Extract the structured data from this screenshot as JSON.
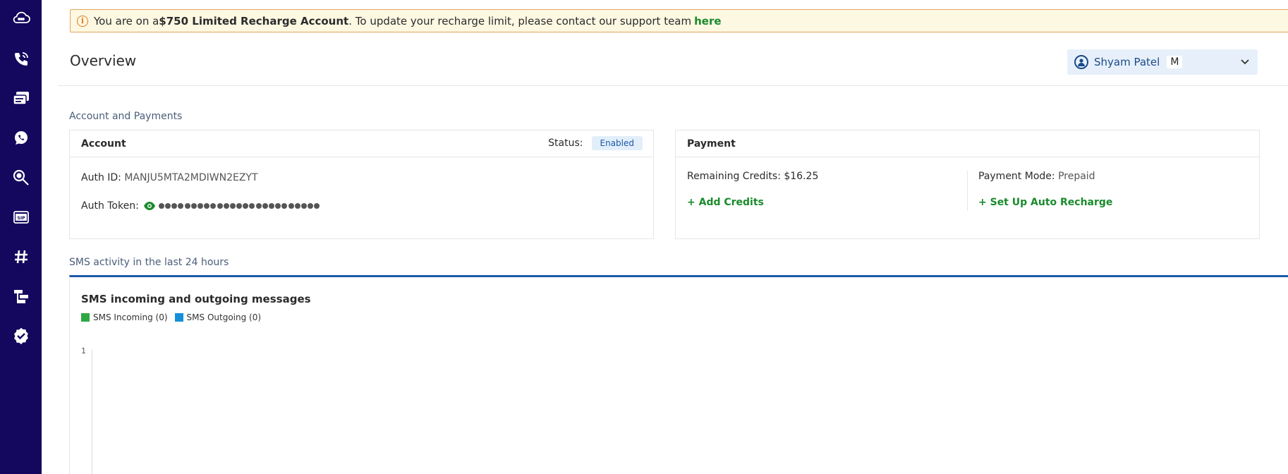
{
  "banner": {
    "prefix": "You are on a ",
    "account_type": "$750 Limited Recharge Account",
    "suffix": ". To update your recharge limit, please contact our support team",
    "link": "here"
  },
  "header": {
    "title": "Overview",
    "user_name": "Shyam Patel",
    "user_initial": "M"
  },
  "sidebar": {
    "items": [
      "cloud-icon",
      "phone-icon",
      "messages-icon",
      "whatsapp-icon",
      "lookup-icon",
      "sip-icon",
      "hashtag-icon",
      "flow-icon",
      "verify-icon"
    ]
  },
  "account_section": {
    "title": "Account and Payments",
    "account": {
      "heading": "Account",
      "status_label": "Status:",
      "status_value": "Enabled",
      "auth_id_label": "Auth ID:",
      "auth_id_value": "MANJU5MTA2MDIWN2EZYT",
      "auth_token_label": "Auth Token:"
    },
    "payment": {
      "heading": "Payment",
      "remaining_label": "Remaining Credits:",
      "remaining_value": "$16.25",
      "add_credits": "+ Add Credits",
      "mode_label": "Payment Mode:",
      "mode_value": "Prepaid",
      "auto_recharge": "+ Set Up Auto Recharge"
    }
  },
  "sms_section": {
    "title": "SMS activity in the last 24 hours"
  },
  "colors": {
    "sidebar": "#14075e",
    "accent_green": "#1a8a2c",
    "accent_blue": "#1d5aa8"
  },
  "chart_data": {
    "type": "line",
    "title": "SMS incoming and outgoing messages",
    "series": [
      {
        "name": "SMS Incoming (0)",
        "color": "#2ea843",
        "values": []
      },
      {
        "name": "SMS Outgoing (0)",
        "color": "#1590d8",
        "values": []
      }
    ],
    "y_ticks": [
      "1"
    ],
    "legend": "top-left"
  }
}
